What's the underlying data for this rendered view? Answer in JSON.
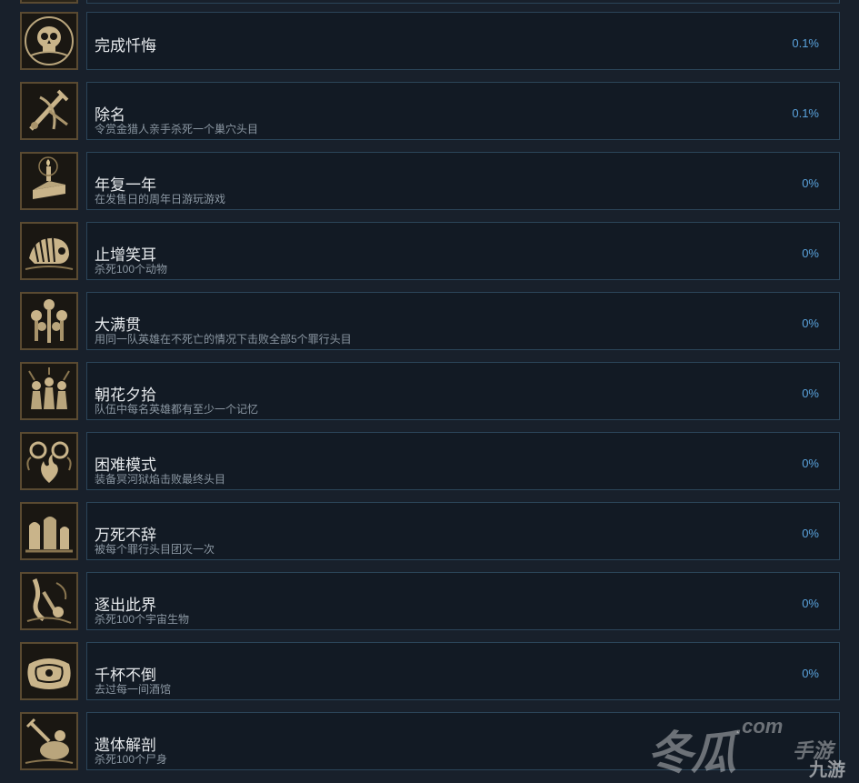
{
  "achievements": [
    {
      "title": "完成忏悔",
      "desc": "",
      "pct": "0.1%",
      "icon": "skull-icon"
    },
    {
      "title": "除名",
      "desc": "令赏金猎人亲手杀死一个巢穴头目",
      "pct": "0.1%",
      "icon": "crossed-weapons-icon"
    },
    {
      "title": "年复一年",
      "desc": "在发售日的周年日游玩游戏",
      "pct": "0%",
      "icon": "cake-candle-icon"
    },
    {
      "title": "止增笑耳",
      "desc": "杀死100个动物",
      "pct": "0%",
      "icon": "beast-icon"
    },
    {
      "title": "大满贯",
      "desc": "用同一队英雄在不死亡的情况下击败全部5个罪行头目",
      "pct": "0%",
      "icon": "trophies-icon"
    },
    {
      "title": "朝花夕拾",
      "desc": "队伍中每名英雄都有至少一个记忆",
      "pct": "0%",
      "icon": "heroes-group-icon"
    },
    {
      "title": "困难模式",
      "desc": "装备冥河狱焰击败最终头目",
      "pct": "0%",
      "icon": "hellfire-icon"
    },
    {
      "title": "万死不辞",
      "desc": "被每个罪行头目团灭一次",
      "pct": "0%",
      "icon": "gravestones-icon"
    },
    {
      "title": "逐出此界",
      "desc": "杀死100个宇宙生物",
      "pct": "0%",
      "icon": "tentacle-icon"
    },
    {
      "title": "千杯不倒",
      "desc": "去过每一间酒馆",
      "pct": "0%",
      "icon": "tavern-pillow-icon"
    },
    {
      "title": "遗体解剖",
      "desc": "杀死100个尸身",
      "pct": "",
      "icon": "corpse-dagger-icon"
    }
  ],
  "watermark": {
    "com": ".com",
    "big": "冬瓜",
    "small": "手游",
    "logo": "九游"
  },
  "colors": {
    "background": "#18202b",
    "panel": "#121a24",
    "border": "#2b4559",
    "percent": "#5aa3dd",
    "iconFrame": "#5a4a31"
  }
}
